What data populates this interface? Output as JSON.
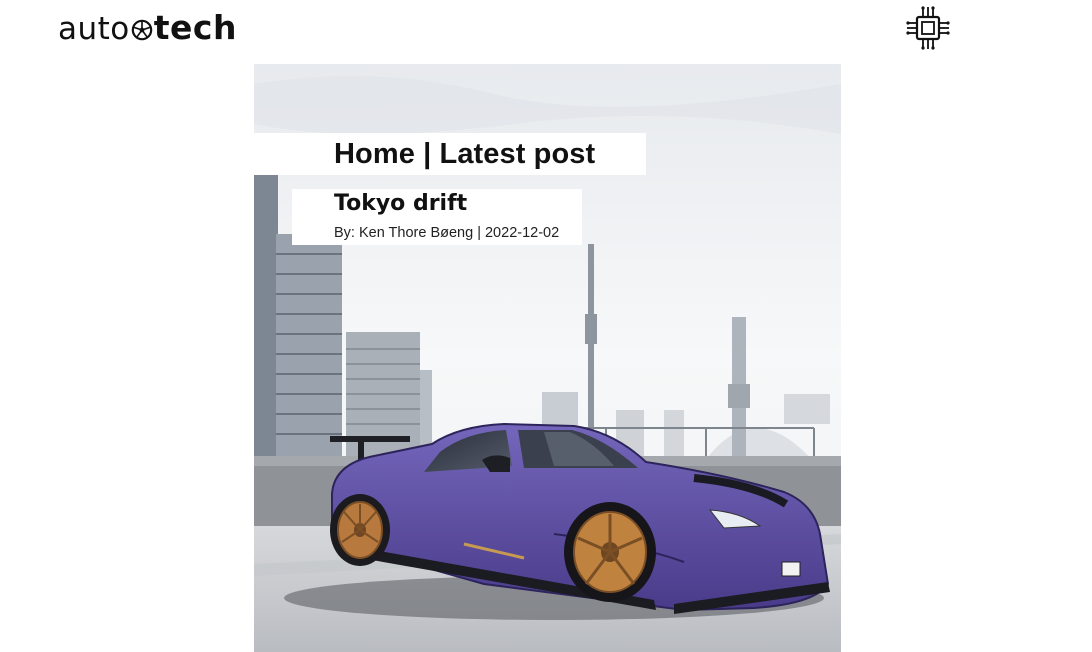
{
  "header": {
    "logo_text_light": "auto",
    "logo_text_bold": "tech",
    "icons": [
      "wheel-icon",
      "circuit-chip-icon"
    ]
  },
  "breadcrumb": {
    "text": "Home | Latest post"
  },
  "post": {
    "title": "Tokyo drift",
    "meta": "By: Ken Thore Bøeng | 2022-12-02"
  },
  "hero": {
    "image_subject": "purple widebody sports car on rooftop parking with city skyline",
    "colors": {
      "car_body": "#5f4fa2",
      "wheels": "#b8793f",
      "sky": "#f3f4f6",
      "ground": "#c9cbcf"
    }
  }
}
